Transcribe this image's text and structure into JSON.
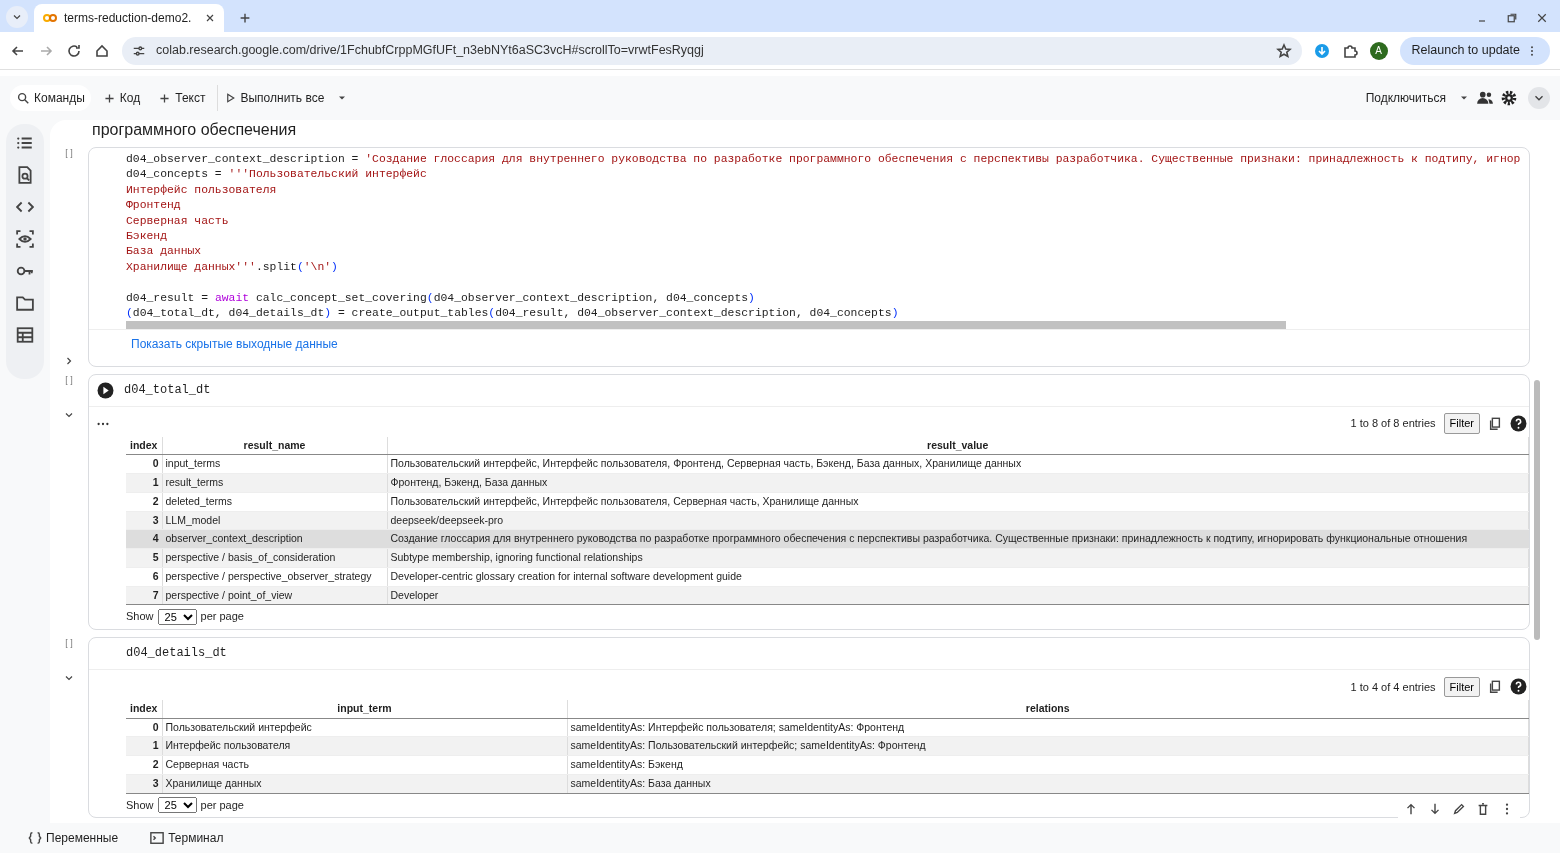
{
  "browser": {
    "tab_title": "terms-reduction-demo2.",
    "url": "colab.research.google.com/drive/1FchubfCrppMGfUFt_n3ebNYt6aSC3vcH#scrollTo=vrwtFesRyqgj",
    "profile_initial": "A",
    "relaunch_label": "Relaunch to update"
  },
  "toolbar": {
    "commands": "Команды",
    "add_code": "Код",
    "add_text": "Текст",
    "run_all": "Выполнить все",
    "connect": "Подключиться"
  },
  "heading_fragment": "программного обеспечения",
  "cells": [
    {
      "kind": "code",
      "prompt": "[ ]",
      "lines": [
        {
          "segments": [
            {
              "kind": "plain",
              "text": "d04_observer_context_description = "
            },
            {
              "kind": "string",
              "text": "'Создание глоссария для внутреннего руководства по разработке программного обеспечения с перспективы разработчика. Существенные признаки: принадлежность к подтипу, игнор"
            }
          ]
        },
        {
          "segments": [
            {
              "kind": "plain",
              "text": "d04_concepts = "
            },
            {
              "kind": "string",
              "text": "'''Пользовательский интерфейс"
            }
          ]
        },
        {
          "segments": [
            {
              "kind": "string",
              "text": "Интерфейс пользователя"
            }
          ]
        },
        {
          "segments": [
            {
              "kind": "string",
              "text": "Фронтенд"
            }
          ]
        },
        {
          "segments": [
            {
              "kind": "string",
              "text": "Серверная часть"
            }
          ]
        },
        {
          "segments": [
            {
              "kind": "string",
              "text": "Бэкенд"
            }
          ]
        },
        {
          "segments": [
            {
              "kind": "string",
              "text": "База данных"
            }
          ]
        },
        {
          "segments": [
            {
              "kind": "string",
              "text": "Хранилище данных'''"
            },
            {
              "kind": "plain",
              "text": ".split"
            },
            {
              "kind": "paren",
              "text": "("
            },
            {
              "kind": "string",
              "text": "'\\n'"
            },
            {
              "kind": "paren",
              "text": ")"
            }
          ]
        },
        {
          "gap_before": true,
          "segments": [
            {
              "kind": "plain",
              "text": "d04_result = "
            },
            {
              "kind": "keyword",
              "text": "await"
            },
            {
              "kind": "plain",
              "text": " calc_concept_set_covering"
            },
            {
              "kind": "paren",
              "text": "("
            },
            {
              "kind": "plain",
              "text": "d04_observer_context_description, d04_concepts"
            },
            {
              "kind": "paren",
              "text": ")"
            }
          ]
        },
        {
          "segments": [
            {
              "kind": "paren",
              "text": "("
            },
            {
              "kind": "plain",
              "text": "d04_total_dt, d04_details_dt"
            },
            {
              "kind": "paren",
              "text": ")"
            },
            {
              "kind": "plain",
              "text": " = create_output_tables"
            },
            {
              "kind": "paren",
              "text": "("
            },
            {
              "kind": "plain",
              "text": "d04_result, d04_observer_context_description, d04_concepts"
            },
            {
              "kind": "paren",
              "text": ")"
            }
          ]
        }
      ],
      "hidden_output_link": "Показать скрытые выходные данные"
    },
    {
      "kind": "table",
      "prompt": "[ ]",
      "run_button": true,
      "more_menu": true,
      "code": "d04_total_dt",
      "info": "1 to 8 of 8 entries",
      "filter": "Filter",
      "columns": [
        "index",
        "result_name",
        "result_value"
      ],
      "rows": [
        {
          "selected": false,
          "cells": [
            "0",
            "input_terms",
            "Пользовательский интерфейс, Интерфейс пользователя, Фронтенд, Серверная часть, Бэкенд, База данных, Хранилище данных"
          ]
        },
        {
          "selected": false,
          "cells": [
            "1",
            "result_terms",
            "Фронтенд, Бэкенд, База данных"
          ]
        },
        {
          "selected": false,
          "cells": [
            "2",
            "deleted_terms",
            "Пользовательский интерфейс, Интерфейс пользователя, Серверная часть, Хранилище данных"
          ]
        },
        {
          "selected": false,
          "cells": [
            "3",
            "LLM_model",
            "deepseek/deepseek-pro"
          ]
        },
        {
          "selected": true,
          "cells": [
            "4",
            "observer_context_description",
            "Создание глоссария для внутреннего руководства по разработке программного обеспечения с перспективы разработчика. Существенные признаки: принадлежность к подтипу, игнорировать функциональные отношения"
          ]
        },
        {
          "selected": false,
          "cells": [
            "5",
            "perspective / basis_of_consideration",
            "Subtype membership, ignoring functional relationships"
          ]
        },
        {
          "selected": false,
          "cells": [
            "6",
            "perspective / perspective_observer_strategy",
            "Developer-centric glossary creation for internal software development guide"
          ]
        },
        {
          "selected": false,
          "cells": [
            "7",
            "perspective / point_of_view",
            "Developer"
          ]
        }
      ],
      "show": "Show",
      "page_size": "25",
      "per_page": "per page"
    },
    {
      "kind": "table",
      "prompt": "[ ]",
      "run_button": false,
      "more_menu": false,
      "code": "d04_details_dt",
      "info": "1 to 4 of 4 entries",
      "filter": "Filter",
      "columns": [
        "index",
        "input_term",
        "relations"
      ],
      "rows": [
        {
          "selected": false,
          "cells": [
            "0",
            "Пользовательский интерфейс",
            "sameIdentityAs: Интерфейс пользователя; sameIdentityAs: Фронтенд"
          ]
        },
        {
          "selected": false,
          "cells": [
            "1",
            "Интерфейс пользователя",
            "sameIdentityAs: Пользовательский интерфейс; sameIdentityAs: Фронтенд"
          ]
        },
        {
          "selected": false,
          "cells": [
            "2",
            "Серверная часть",
            "sameIdentityAs: Бэкенд"
          ]
        },
        {
          "selected": false,
          "cells": [
            "3",
            "Хранилище данных",
            "sameIdentityAs: База данных"
          ]
        }
      ],
      "show": "Show",
      "page_size": "25",
      "per_page": "per page"
    }
  ],
  "bottom_bar": {
    "variables": "Переменные",
    "terminal": "Терминал"
  }
}
